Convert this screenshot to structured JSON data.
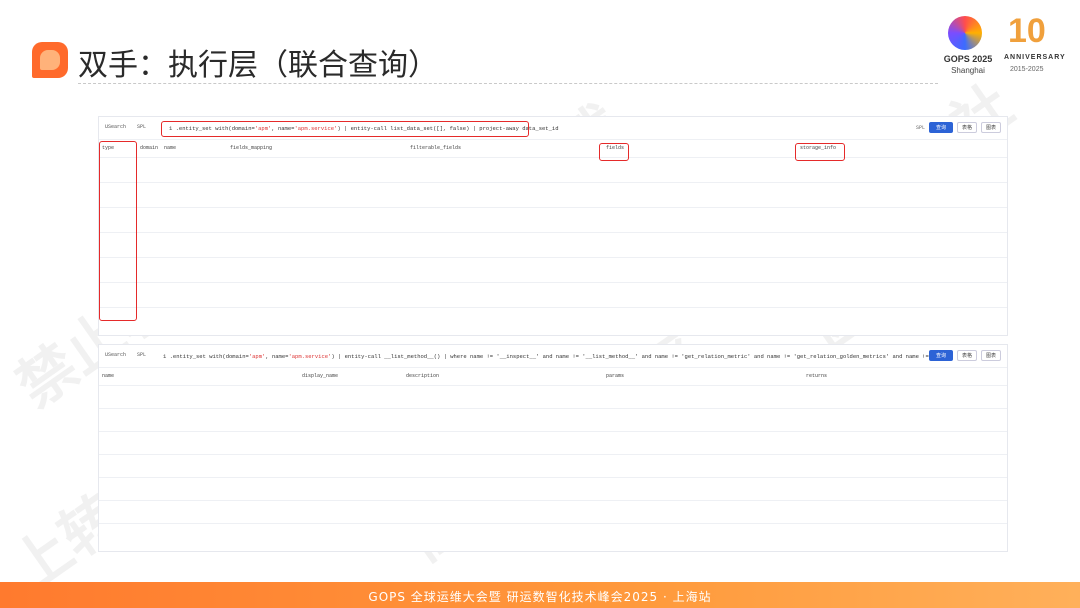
{
  "slide": {
    "title": "双手：执行层（联合查询）",
    "logo_text": "GOPS 2025",
    "logo_sub": "Shanghai",
    "anniversary_num": "10",
    "anniversary_text": "ANNIVERSARY",
    "anniversary_years": "2015-2025",
    "footer": "GOPS 全球运维大会暨 研运数智化技术峰会2025 · 上海站",
    "watermarks": [
      "禁止转载",
      "高效运维社区",
      "高效运维社区",
      "禁止转载",
      "上转载"
    ]
  },
  "panel1": {
    "tabs": [
      "USearch",
      "SPL"
    ],
    "query_prefix": "1 .entity_set with(domain=",
    "query_domain": "'apm'",
    "query_mid": ", name=",
    "query_name": "'apm.service'",
    "query_rest": ") | entity-call list_data_set([], false) | project-away data_set_id",
    "right_label": "SPL",
    "search_button": "查询",
    "btn_a": "表格",
    "btn_b": "图表",
    "columns": [
      "type",
      "domain",
      "name",
      "fields_mapping",
      "filterable_fields",
      "fields",
      "storage_info"
    ],
    "rows": [
      [
        "",
        "",
        "",
        "",
        "",
        "",
        ""
      ],
      [
        "",
        "",
        "",
        "",
        "",
        "",
        ""
      ],
      [
        "",
        "",
        "",
        "",
        "",
        "",
        ""
      ],
      [
        "",
        "",
        "",
        "",
        "",
        "",
        ""
      ],
      [
        "",
        "",
        "",
        "",
        "",
        "",
        ""
      ],
      [
        "",
        "",
        "",
        "",
        "",
        "",
        ""
      ]
    ]
  },
  "panel2": {
    "tabs": [
      "USearch",
      "SPL"
    ],
    "query_prefix": "1 .entity_set with(domain=",
    "query_domain": "'apm'",
    "query_mid": ", name=",
    "query_name": "'apm.service'",
    "query_rest": ") | entity-call __list_method__() | where name != '__inspect__' and name != '__list_method__' and name != 'get_relation_metric' and name != 'get_relation_golden_metrics' and name !=",
    "search_button": "查询",
    "btn_a": "表格",
    "btn_b": "图表",
    "columns": [
      "name",
      "display_name",
      "description",
      "params",
      "returns"
    ],
    "rows": [
      [
        "",
        "",
        "",
        "",
        ""
      ],
      [
        "",
        "",
        "",
        "",
        ""
      ],
      [
        "",
        "",
        "",
        "",
        ""
      ],
      [
        "",
        "",
        "",
        "",
        ""
      ],
      [
        "",
        "",
        "",
        "",
        ""
      ],
      [
        "",
        "",
        "",
        "",
        ""
      ]
    ]
  }
}
